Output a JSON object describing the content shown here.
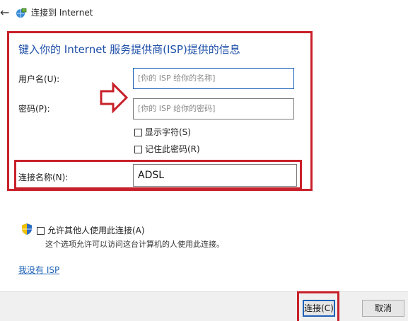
{
  "window": {
    "title": "连接到 Internet"
  },
  "form": {
    "heading": "键入你的 Internet 服务提供商(ISP)提供的信息",
    "username_label": "用户名(U):",
    "username_placeholder": "[你的 ISP 给你的名称]",
    "password_label": "密码(P):",
    "password_placeholder": "[你的 ISP 给你的密码]",
    "show_chars_label": "显示字符(S)",
    "remember_label": "记住此密码(R)",
    "connection_name_label": "连接名称(N):",
    "connection_name_value": "ADSL"
  },
  "sharing": {
    "allow_label": "允许其他人使用此连接(A)",
    "description": "这个选项允许可以访问这台计算机的人使用此连接。"
  },
  "links": {
    "no_isp": "我没有 ISP"
  },
  "buttons": {
    "connect": "连接(C)",
    "cancel": "取消"
  },
  "colors": {
    "annotation_red": "#c8202a",
    "heading_blue": "#1e4fa8",
    "link_blue": "#1e62b8"
  }
}
